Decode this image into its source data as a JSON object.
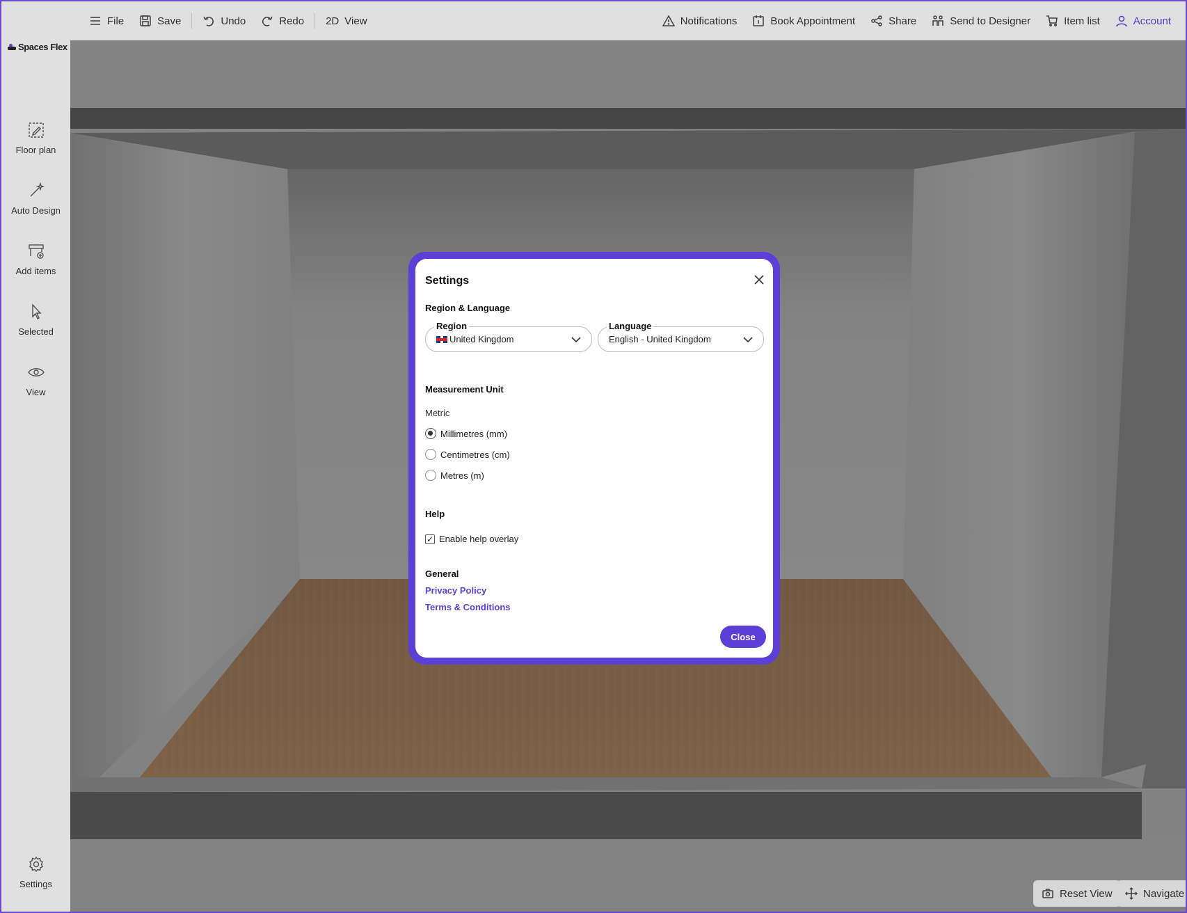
{
  "app": {
    "logo_text": "Spaces Flex",
    "accent_color": "#5b3fd6"
  },
  "topbar": {
    "left": [
      {
        "label": "File",
        "icon": "menu-icon"
      },
      {
        "label": "Save",
        "icon": "save-icon"
      },
      {
        "label": "Undo",
        "icon": "undo-icon"
      },
      {
        "label": "Redo",
        "icon": "redo-icon"
      },
      {
        "label": "View",
        "icon": "2d-label",
        "prefix": "2D"
      }
    ],
    "right": [
      {
        "label": "Notifications",
        "icon": "warning-icon"
      },
      {
        "label": "Book Appointment",
        "icon": "calendar-icon"
      },
      {
        "label": "Share",
        "icon": "share-icon"
      },
      {
        "label": "Send to Designer",
        "icon": "send-designer-icon"
      },
      {
        "label": "Item list",
        "icon": "cart-icon"
      },
      {
        "label": "Account",
        "icon": "user-icon"
      }
    ]
  },
  "sidebar": {
    "items": [
      {
        "label": "Floor plan",
        "icon": "floor-plan-icon"
      },
      {
        "label": "Auto Design",
        "icon": "magic-wand-icon"
      },
      {
        "label": "Add items",
        "icon": "add-items-icon"
      },
      {
        "label": "Selected",
        "icon": "cursor-icon"
      },
      {
        "label": "View",
        "icon": "eye-icon"
      }
    ],
    "settings_label": "Settings"
  },
  "view_controls": {
    "reset_label": "Reset View",
    "navigate_label": "Navigate"
  },
  "settings_modal": {
    "title": "Settings",
    "region_language_heading": "Region & Language",
    "region": {
      "legend": "Region",
      "value": "United Kingdom"
    },
    "language": {
      "legend": "Language",
      "value": "English - United Kingdom"
    },
    "measurement_heading": "Measurement Unit",
    "metric_label": "Metric",
    "units": [
      {
        "label": "Millimetres (mm)",
        "checked": true
      },
      {
        "label": "Centimetres (cm)",
        "checked": false
      },
      {
        "label": "Metres (m)",
        "checked": false
      }
    ],
    "help_heading": "Help",
    "help_overlay_label": "Enable help overlay",
    "help_overlay_checked": true,
    "general_heading": "General",
    "privacy_link": "Privacy Policy",
    "terms_link": "Terms & Conditions",
    "close_button": "Close"
  }
}
